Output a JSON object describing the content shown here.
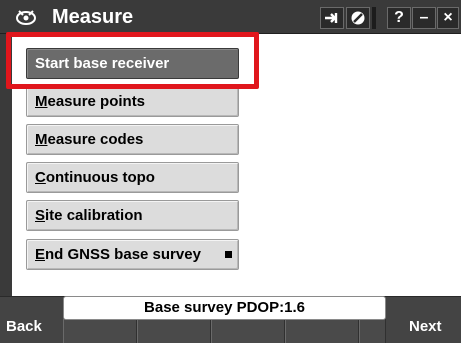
{
  "window": {
    "title": "Measure",
    "icons": [
      "trimble-app-icon",
      "switch-to-icon",
      "map-toggle-icon",
      "help-icon",
      "minimize-icon",
      "close-icon"
    ],
    "help_glyph": "?",
    "minimize_glyph": "–",
    "close_glyph": "×"
  },
  "menu": {
    "items": [
      {
        "label_pre": "",
        "label_key": "",
        "label_post": "Start base receiver",
        "selected": true
      },
      {
        "label_pre": "",
        "label_key": "M",
        "label_post": "easure points",
        "selected": false
      },
      {
        "label_pre": "",
        "label_key": "M",
        "label_post": "easure codes",
        "selected": false
      },
      {
        "label_pre": "",
        "label_key": "C",
        "label_post": "ontinuous topo",
        "selected": false
      },
      {
        "label_pre": "",
        "label_key": "S",
        "label_post": "ite calibration",
        "selected": false
      },
      {
        "label_pre": "",
        "label_key": "E",
        "label_post": "nd GNSS base survey",
        "selected": false
      }
    ]
  },
  "status": {
    "text": "Base survey  PDOP:1.6"
  },
  "softkeys": {
    "back_label": "Back",
    "next_label": "Next"
  },
  "colors": {
    "highlight": "#e0161c",
    "titlebar": "#3a3a3a",
    "selected_button": "#6b6b6b"
  }
}
